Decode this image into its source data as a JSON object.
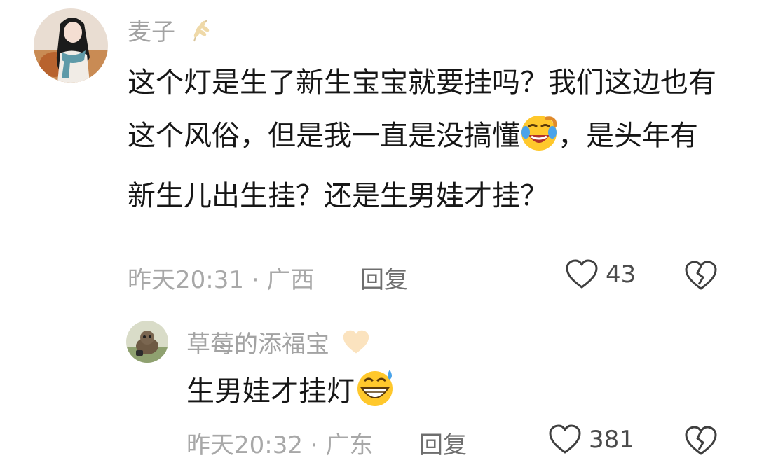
{
  "comments": [
    {
      "username": "麦子",
      "name_icon": "wheat-icon",
      "text_part1": "这个灯是生了新生宝宝就要挂吗？我们这边也有这个风俗，但是我一直是没搞懂",
      "text_emoji": "laughing-crying-emoji",
      "text_part2": "，是头年有新生儿出生挂？还是生男娃才挂？",
      "time": "昨天20:31 · 广西",
      "reply_label": "回复",
      "likes": "43"
    }
  ],
  "reply": {
    "username": "草莓的添福宝",
    "name_icon": "heart-icon",
    "text": "生男娃才挂灯",
    "text_emoji": "grinning-sweat-emoji",
    "time": "昨天20:32 · 广东",
    "reply_label": "回复",
    "likes": "381"
  },
  "colors": {
    "username": "#a3a3a3",
    "meta": "#a8a8a8",
    "text": "#161616",
    "icon_stroke": "#3f3f3f"
  }
}
